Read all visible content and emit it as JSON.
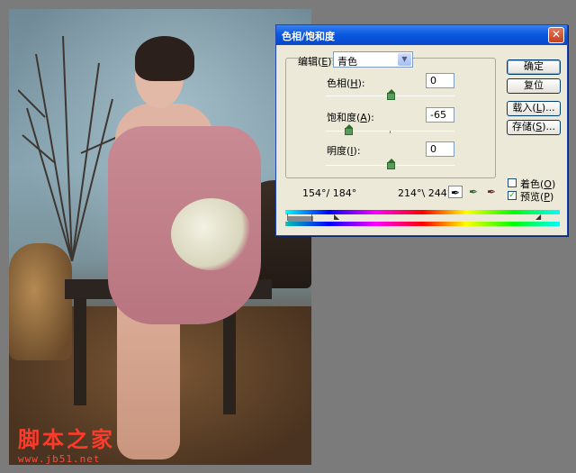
{
  "watermark": {
    "cn": "脚本之家",
    "url": "www.jb51.net"
  },
  "dialog": {
    "title": "色相/饱和度",
    "close_glyph": "✕",
    "edit": {
      "label_pre": "编辑(",
      "key": "E",
      "label_post": "):",
      "value": "青色"
    },
    "hue": {
      "label_pre": "色相(",
      "key": "H",
      "label_post": "):",
      "value": "0",
      "level": 0
    },
    "saturation": {
      "label_pre": "饱和度(",
      "key": "A",
      "label_post": "):",
      "value": "-65",
      "level": -65
    },
    "lightness": {
      "label_pre": "明度(",
      "key": "I",
      "label_post": "):",
      "value": "0",
      "level": 0
    },
    "range_left": "154°/ 184°",
    "range_right": "214°\\ 244°",
    "buttons": {
      "ok": "确定",
      "reset": "复位",
      "load_pre": "载入(",
      "load_key": "L",
      "load_post": ")...",
      "save_pre": "存储(",
      "save_key": "S",
      "save_post": ")..."
    },
    "colorize": {
      "label_pre": "着色(",
      "key": "O",
      "label_post": ")",
      "checked": false
    },
    "preview": {
      "label_pre": "预览(",
      "key": "P",
      "label_post": ")",
      "checked": true
    },
    "check_glyph": "✓",
    "eyedropper_glyphs": [
      "✒",
      "✒",
      "✒"
    ],
    "colors": {
      "title_blue": "#0a5ae0",
      "dialog_bg": "#ece9d8",
      "thumb_green": "#5a9a5a"
    }
  }
}
